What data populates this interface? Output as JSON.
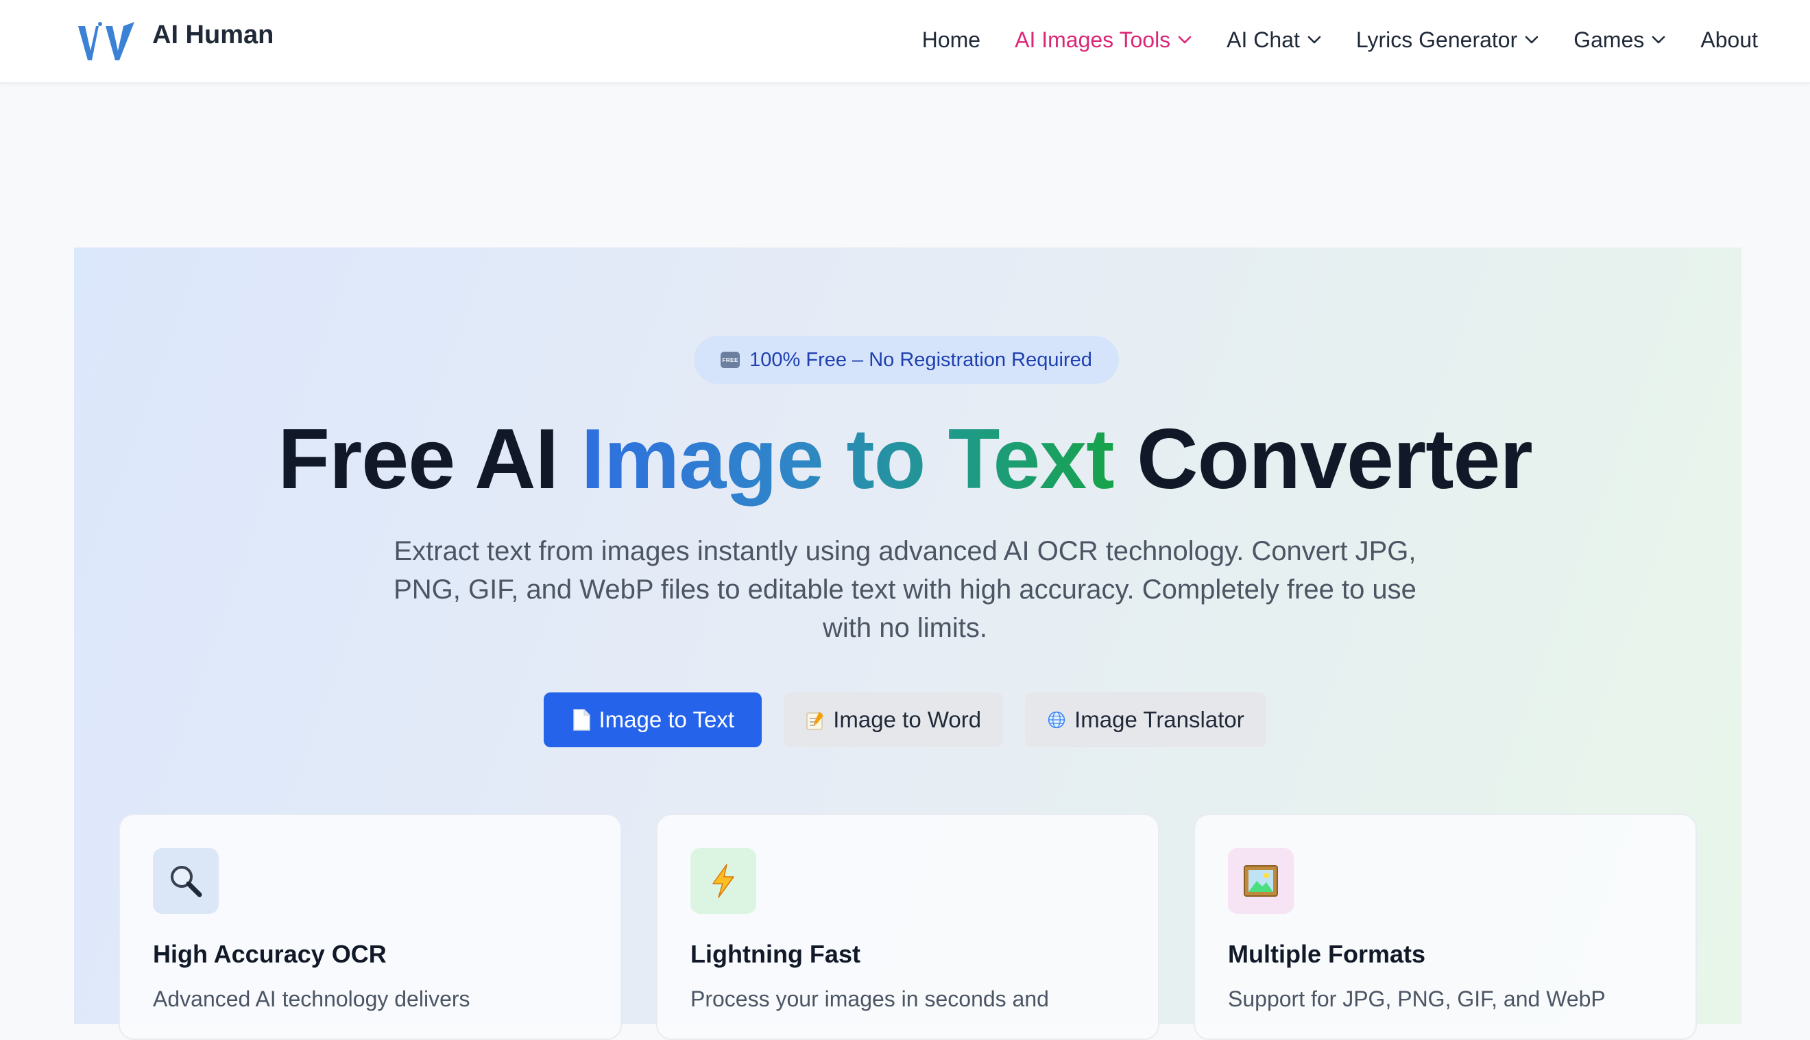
{
  "brand": {
    "name": "AI Human",
    "logo_icon": "vv-logo-icon",
    "color": "#3b82d6"
  },
  "nav": {
    "items": [
      {
        "label": "Home",
        "active": false,
        "dropdown": false
      },
      {
        "label": "AI Images Tools",
        "active": true,
        "dropdown": true
      },
      {
        "label": "AI Chat",
        "active": false,
        "dropdown": true
      },
      {
        "label": "Lyrics Generator",
        "active": false,
        "dropdown": true
      },
      {
        "label": "Games",
        "active": false,
        "dropdown": true
      },
      {
        "label": "About",
        "active": false,
        "dropdown": false
      }
    ],
    "active_color": "#db2777"
  },
  "hero": {
    "badge": {
      "icon": "free-icon",
      "icon_text": "FREE",
      "text": "100% Free – No Registration Required"
    },
    "title": {
      "part1": "Free AI ",
      "highlight": "Image to Text",
      "part2": " Converter"
    },
    "subtitle": "Extract text from images instantly using advanced AI OCR technology. Convert JPG, PNG, GIF, and WebP files to editable text with high accuracy. Completely free to use with no limits.",
    "buttons": [
      {
        "label": "Image to Text",
        "icon": "page-icon",
        "variant": "primary"
      },
      {
        "label": "Image to Word",
        "icon": "memo-icon",
        "variant": "secondary"
      },
      {
        "label": "Image Translator",
        "icon": "globe-icon",
        "variant": "secondary"
      }
    ],
    "accent_color": "#2563eb"
  },
  "features": [
    {
      "icon": "magnifier-icon",
      "title": "High Accuracy OCR",
      "desc": "Advanced AI technology delivers",
      "icon_bg": "#dbe6f7"
    },
    {
      "icon": "lightning-icon",
      "title": "Lightning Fast",
      "desc": "Process your images in seconds and",
      "icon_bg": "#dcf5e3"
    },
    {
      "icon": "picture-icon",
      "title": "Multiple Formats",
      "desc": "Support for JPG, PNG, GIF, and WebP",
      "icon_bg": "#f6e3f3"
    }
  ]
}
